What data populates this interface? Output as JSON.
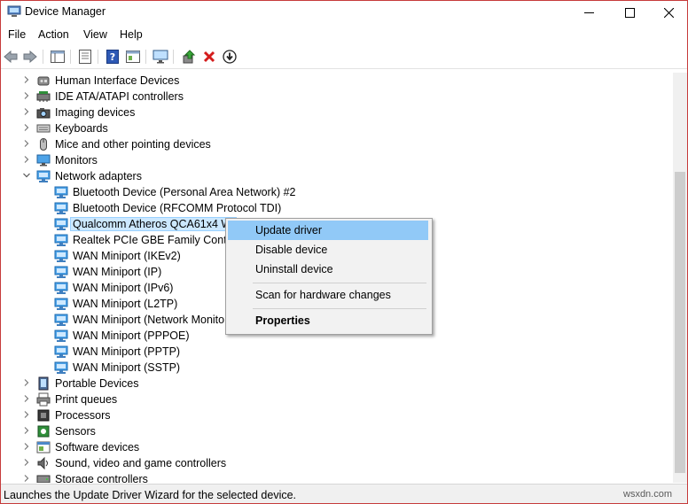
{
  "window": {
    "title": "Device Manager",
    "controls": {
      "minimize": "—",
      "maximize": "☐",
      "close": "✕"
    }
  },
  "menu": [
    "File",
    "Action",
    "View",
    "Help"
  ],
  "tree": [
    {
      "label": "Human Interface Devices",
      "level": 0,
      "state": "collapsed",
      "icon": "hid-icon"
    },
    {
      "label": "IDE ATA/ATAPI controllers",
      "level": 0,
      "state": "collapsed",
      "icon": "ide-icon"
    },
    {
      "label": "Imaging devices",
      "level": 0,
      "state": "collapsed",
      "icon": "camera-icon"
    },
    {
      "label": "Keyboards",
      "level": 0,
      "state": "collapsed",
      "icon": "keyboard-icon"
    },
    {
      "label": "Mice and other pointing devices",
      "level": 0,
      "state": "collapsed",
      "icon": "mouse-icon"
    },
    {
      "label": "Monitors",
      "level": 0,
      "state": "collapsed",
      "icon": "monitor-icon"
    },
    {
      "label": "Network adapters",
      "level": 0,
      "state": "expanded",
      "icon": "network-icon"
    },
    {
      "label": "Bluetooth Device (Personal Area Network) #2",
      "level": 1,
      "icon": "network-icon"
    },
    {
      "label": "Bluetooth Device (RFCOMM Protocol TDI)",
      "level": 1,
      "icon": "network-icon"
    },
    {
      "label": "Qualcomm Atheros QCA61x4 Wi",
      "level": 1,
      "icon": "network-icon",
      "selected": true
    },
    {
      "label": "Realtek PCIe GBE Family Control",
      "level": 1,
      "icon": "network-icon"
    },
    {
      "label": "WAN Miniport (IKEv2)",
      "level": 1,
      "icon": "network-icon"
    },
    {
      "label": "WAN Miniport (IP)",
      "level": 1,
      "icon": "network-icon"
    },
    {
      "label": "WAN Miniport (IPv6)",
      "level": 1,
      "icon": "network-icon"
    },
    {
      "label": "WAN Miniport (L2TP)",
      "level": 1,
      "icon": "network-icon"
    },
    {
      "label": "WAN Miniport (Network Monito",
      "level": 1,
      "icon": "network-icon"
    },
    {
      "label": "WAN Miniport (PPPOE)",
      "level": 1,
      "icon": "network-icon"
    },
    {
      "label": "WAN Miniport (PPTP)",
      "level": 1,
      "icon": "network-icon"
    },
    {
      "label": "WAN Miniport (SSTP)",
      "level": 1,
      "icon": "network-icon"
    },
    {
      "label": "Portable Devices",
      "level": 0,
      "state": "collapsed",
      "icon": "portable-icon"
    },
    {
      "label": "Print queues",
      "level": 0,
      "state": "collapsed",
      "icon": "printer-icon"
    },
    {
      "label": "Processors",
      "level": 0,
      "state": "collapsed",
      "icon": "processor-icon"
    },
    {
      "label": "Sensors",
      "level": 0,
      "state": "collapsed",
      "icon": "sensor-icon"
    },
    {
      "label": "Software devices",
      "level": 0,
      "state": "collapsed",
      "icon": "software-icon"
    },
    {
      "label": "Sound, video and game controllers",
      "level": 0,
      "state": "collapsed",
      "icon": "sound-icon"
    },
    {
      "label": "Storage controllers",
      "level": 0,
      "state": "collapsed",
      "icon": "storage-icon"
    }
  ],
  "context_menu": {
    "items": [
      {
        "label": "Update driver",
        "highlighted": true
      },
      {
        "label": "Disable device"
      },
      {
        "label": "Uninstall device"
      },
      {
        "separator": true
      },
      {
        "label": "Scan for hardware changes"
      },
      {
        "separator": true
      },
      {
        "label": "Properties",
        "bold": true
      }
    ]
  },
  "status": {
    "text": "Launches the Update Driver Wizard for the selected device."
  },
  "watermark": "wsxdn.com",
  "colors": {
    "highlight": "#91c9f7",
    "selection": "#cce8ff",
    "network_icon": "#2f8ad6",
    "window_border": "#c63b3b"
  }
}
